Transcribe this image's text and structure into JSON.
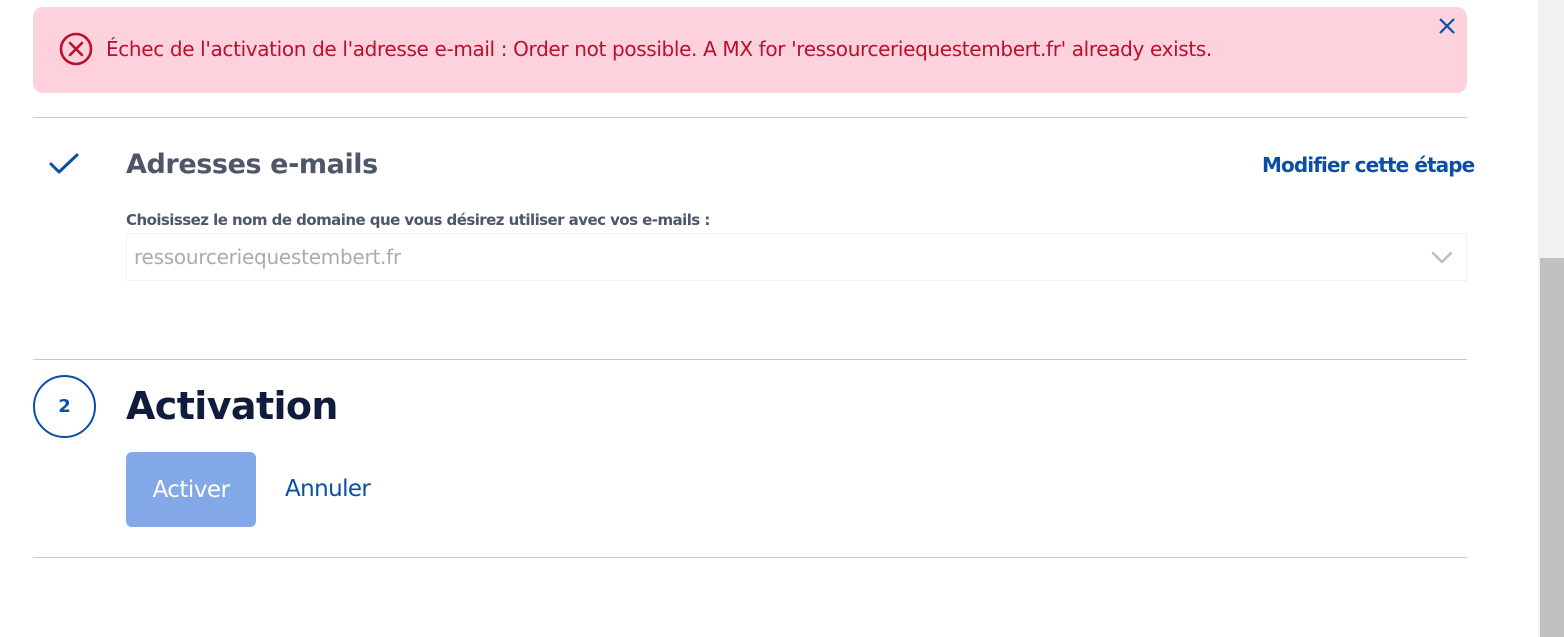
{
  "alert": {
    "message": "Échec de l'activation de l'adresse e-mail : Order not possible. A MX for 'ressourceriequestembert.fr' already exists.",
    "icon": "error-circle-icon",
    "close_icon": "close-icon",
    "color_bg": "#fdd2dc",
    "color_text": "#bc0f2c"
  },
  "step1": {
    "status_icon": "checkmark-icon",
    "title": "Adresses e-mails",
    "edit_label": "Modifier cette étape",
    "domain_label": "Choisissez le nom de domaine que vous désirez utiliser avec vos e-mails :",
    "domain_value": "ressourceriequestembert.fr",
    "dropdown_icon": "chevron-down-icon"
  },
  "step2": {
    "number": "2",
    "title": "Activation",
    "activate_label": "Activer",
    "cancel_label": "Annuler"
  },
  "colors": {
    "accent": "#0a4fa3",
    "button_disabled": "#82a8e8",
    "divider": "#c6c9cf"
  }
}
